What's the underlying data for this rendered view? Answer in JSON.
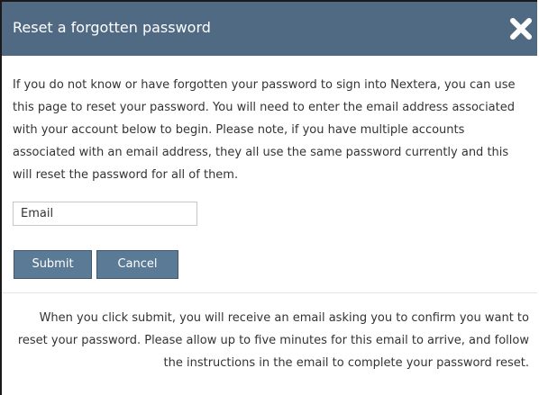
{
  "dialog": {
    "title": "Reset a forgotten password",
    "close_icon": "close-icon"
  },
  "intro_text": "If you do not know or have forgotten your password to sign into Nextera, you can use this page to reset your password. You will need to enter the email address associated with your account below to begin. Please note, if you have multiple accounts associated with an email address, they all use the same password currently and this will reset the password for all of them.",
  "form": {
    "email_placeholder": "Email",
    "email_value": "",
    "submit_label": "Submit",
    "cancel_label": "Cancel"
  },
  "footer_text": "When you click submit, you will receive an email asking you to confirm you want to reset your password. Please allow up to five minutes for this email to arrive, and follow the instructions in the email to complete your password reset.",
  "colors": {
    "header_bg": "#506a83",
    "button_bg": "#5b7a96",
    "text": "#333333"
  }
}
